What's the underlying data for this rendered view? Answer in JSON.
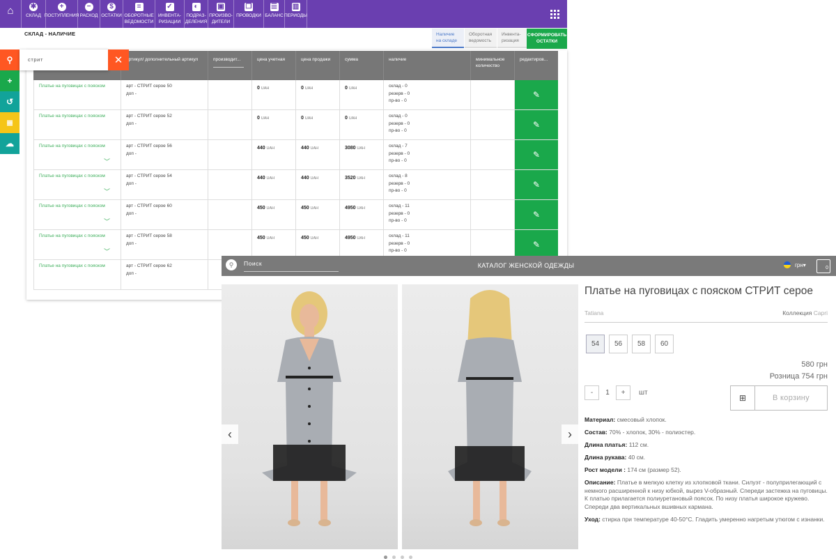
{
  "admin": {
    "toolbar": [
      {
        "icon": "plus-circle-icon",
        "glyph": "+",
        "label": "ПОСТУПЛЕНИЯ"
      },
      {
        "icon": "minus-circle-icon",
        "glyph": "−",
        "label": "РАСХОД"
      },
      {
        "icon": "dollar-icon",
        "glyph": "$",
        "label": "ОСТАТКИ"
      },
      {
        "icon": "document-icon",
        "glyph": "≡",
        "label": "ОБОРОТНЫЕ ВЕДОМОСТИ"
      },
      {
        "icon": "checkbox-icon",
        "glyph": "✓",
        "label": "ИНВЕНТА- РИЗАЦИИ"
      },
      {
        "icon": "half-circle-icon",
        "glyph": "◐",
        "label": "ПОДРАЗ- ДЕЛЕНИЯ"
      },
      {
        "icon": "factory-icon",
        "glyph": "▣",
        "label": "ПРОИЗВО- ДИТЕЛИ"
      },
      {
        "icon": "pages-icon",
        "glyph": "❐",
        "label": "ПРОВОДКИ"
      },
      {
        "icon": "balance-icon",
        "glyph": "☰",
        "label": "БАЛАНС"
      },
      {
        "icon": "columns-icon",
        "glyph": "▥",
        "label": "ПЕРИОДЫ"
      }
    ],
    "warehouse_label": "СКЛАД",
    "page_title": "СКЛАД - НАЛИЧИЕ",
    "tabs": [
      "Наличие на складе",
      "Оборотная ведомость",
      "Инвента- ризация"
    ],
    "form_button": "СФОРМИРОВАТЬ ОСТАТКИ",
    "search_value": "стрит",
    "columns": [
      "артикул/ дополнительный артикул",
      "производит...",
      "цена учетная",
      "цена продажи",
      "сумма",
      "наличие",
      "минимальное количество",
      "редактиров..."
    ],
    "currency": "UAH",
    "rows": [
      {
        "name": "Платье на пуговицах с пояском",
        "art": "арт - СТРИТ серое 50",
        "dop": "доп -",
        "price": "0",
        "sale": "0",
        "sum": "0",
        "stock": "склад - 0",
        "reserve": "резерв - 0",
        "prod": "пр-во - 0",
        "chevron": false
      },
      {
        "name": "Платье на пуговицах с пояском",
        "art": "арт - СТРИТ серое 52",
        "dop": "доп -",
        "price": "0",
        "sale": "0",
        "sum": "0",
        "stock": "склад - 0",
        "reserve": "резерв - 0",
        "prod": "пр-во - 0",
        "chevron": false
      },
      {
        "name": "Платье на пуговицах с пояском",
        "art": "арт - СТРИТ серое 56",
        "dop": "доп -",
        "price": "440",
        "sale": "440",
        "sum": "3080",
        "stock": "склад - 7",
        "reserve": "резерв - 0",
        "prod": "пр-во - 0",
        "chevron": true
      },
      {
        "name": "Платье на пуговицах с пояском",
        "art": "арт - СТРИТ серое 54",
        "dop": "доп -",
        "price": "440",
        "sale": "440",
        "sum": "3520",
        "stock": "склад - 8",
        "reserve": "резерв - 0",
        "prod": "пр-во - 0",
        "chevron": true
      },
      {
        "name": "Платье на пуговицах с пояском",
        "art": "арт - СТРИТ серое 60",
        "dop": "доп -",
        "price": "450",
        "sale": "450",
        "sum": "4950",
        "stock": "склад - 11",
        "reserve": "резерв - 0",
        "prod": "пр-во - 0",
        "chevron": true
      },
      {
        "name": "Платье на пуговицах с пояском",
        "art": "арт - СТРИТ серое 58",
        "dop": "доп -",
        "price": "450",
        "sale": "450",
        "sum": "4950",
        "stock": "склад - 11",
        "reserve": "резерв - 0",
        "prod": "пр-во - 0",
        "chevron": true
      },
      {
        "name": "Платье на пуговицах с пояском",
        "art": "арт - СТРИТ серое 62",
        "dop": "доп -",
        "price": "",
        "sale": "",
        "sum": "",
        "stock": "",
        "reserve": "",
        "prod": "",
        "chevron": false
      }
    ],
    "colors": {
      "toolbar": "#6a3fb0",
      "green": "#1aa84b",
      "orange": "#ff5722"
    }
  },
  "shop": {
    "search_placeholder": "Поиск",
    "catalog_title": "КАТАЛОГ ЖЕНСКОЙ ОДЕЖДЫ",
    "currency": "грн",
    "cart_count": "0",
    "product_title": "Платье на пуговицах с пояском СТРИТ серое",
    "brand": "Tatiana",
    "collection_label": "Коллекция",
    "collection_value": "Capri",
    "sizes": [
      "54",
      "56",
      "58",
      "60"
    ],
    "selected_size": "54",
    "price": "580 грн",
    "retail": "Розница 754 грн",
    "qty_minus": "-",
    "qty": "1",
    "qty_plus": "+",
    "unit": "шт",
    "cart_button": "В корзину",
    "specs": [
      {
        "k": "Материал:",
        "v": "смесовый хлопок."
      },
      {
        "k": "Состав:",
        "v": "70% - хлопок, 30% - полиэстер."
      },
      {
        "k": "Длина платья:",
        "v": "112 см."
      },
      {
        "k": "Длина рукава:",
        "v": "40 см."
      },
      {
        "k": "Рост модели :",
        "v": "174 см (размер 52)."
      },
      {
        "k": "Описание:",
        "v": "Платье в мелкую клетку из хлопковой ткани. Силуэт - полуприлегающий с немного расширенной к низу юбкой, вырез V-образный. Спереди застежка на пуговицы. К платью прилагается полиуретановый поясок. По низу платья широкое кружево. Спереди два вертикальных вшивных кармана."
      },
      {
        "k": "Уход:",
        "v": "стирка при температуре 40-50°С. Гладить умеренно нагретым утюгом с изнанки."
      }
    ]
  }
}
